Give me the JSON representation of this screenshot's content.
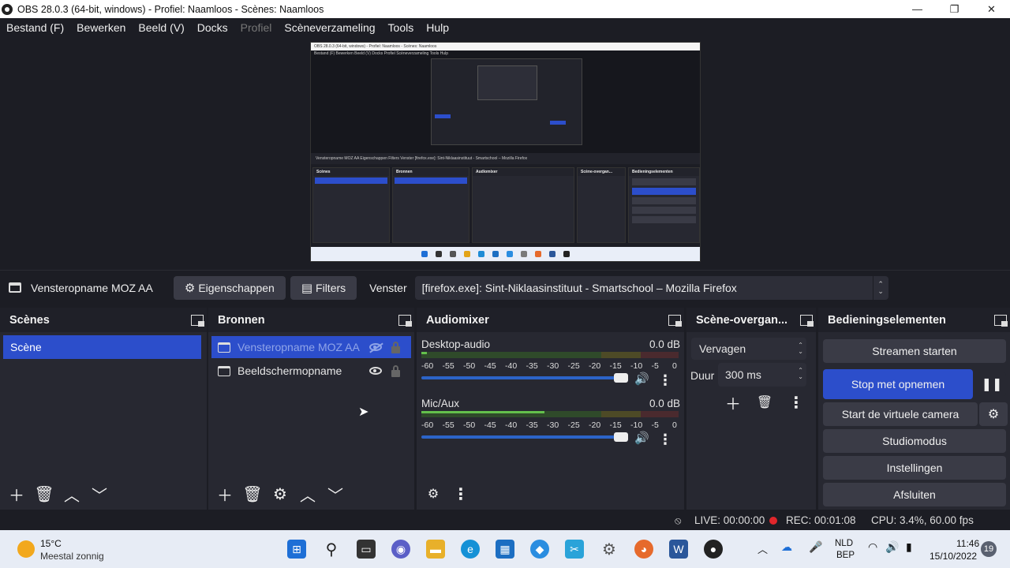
{
  "titlebar": {
    "title": "OBS 28.0.3 (64-bit, windows) - Profiel: Naamloos - Scènes: Naamloos",
    "minimize": "—",
    "maximize": "❐",
    "close": "✕"
  },
  "menu": [
    "Bestand (F)",
    "Bewerken",
    "Beeld (V)",
    "Docks",
    "Profiel",
    "Scèneverzameling",
    "Tools",
    "Hulp"
  ],
  "preview": {
    "title": "OBS 28.0.3 (64-bit, windows) - Profiel: Naamloos - Scènes: Naamloos",
    "menu": "Bestand (F)   Bewerken   Beeld (V)   Docks   Profiel   Scèneverzameling   Tools   Hulp",
    "bar": "Vensteropname MOZ AA    Eigenschappen    Filters    Venster    [firefox.exe]: Sint-Niklaasinstituut - Smartschool – Mozilla Firefox"
  },
  "toolbar": {
    "source_name": "Vensteropname MOZ AA",
    "properties_label": "Eigenschappen",
    "filters_label": "Filters",
    "window_label": "Venster",
    "window_value": "[firefox.exe]: Sint-Niklaasinstituut - Smartschool – Mozilla Firefox"
  },
  "scenes": {
    "title": "Scènes",
    "items": [
      "Scène"
    ]
  },
  "sources": {
    "title": "Bronnen",
    "items": [
      {
        "name": "Vensteropname MOZ AA",
        "visible": false
      },
      {
        "name": "Beeldschermopname",
        "visible": true
      }
    ]
  },
  "mixer": {
    "title": "Audiomixer",
    "channels": [
      {
        "name": "Desktop-audio",
        "db": "0.0 dB",
        "level": 0.02
      },
      {
        "name": "Mic/Aux",
        "db": "0.0 dB",
        "level": 0.48
      }
    ],
    "scale": [
      "-60",
      "-55",
      "-50",
      "-45",
      "-40",
      "-35",
      "-30",
      "-25",
      "-20",
      "-15",
      "-10",
      "-5",
      "0"
    ]
  },
  "transitions": {
    "title": "Scène-overgan...",
    "type": "Vervagen",
    "duration_label": "Duur",
    "duration_value": "300 ms"
  },
  "controls": {
    "title": "Bedieningselementen",
    "stream": "Streamen starten",
    "record": "Stop met opnemen",
    "virtualcam": "Start de virtuele camera",
    "studio": "Studiomodus",
    "settings": "Instellingen",
    "exit": "Afsluiten"
  },
  "status": {
    "live": "LIVE: 00:00:00",
    "rec": "REC: 00:01:08",
    "cpu": "CPU: 3.4%, 60.00 fps"
  },
  "taskbar": {
    "temp": "15°C",
    "weather": "Meestal zonnig",
    "lang1": "NLD",
    "lang2": "BEP",
    "time": "11:46",
    "date": "15/10/2022",
    "badge": "19"
  },
  "colors": {
    "accent": "#2c4ecb",
    "panel": "#272831",
    "background": "#1c1d24",
    "rec_dot": "#e0262b"
  }
}
